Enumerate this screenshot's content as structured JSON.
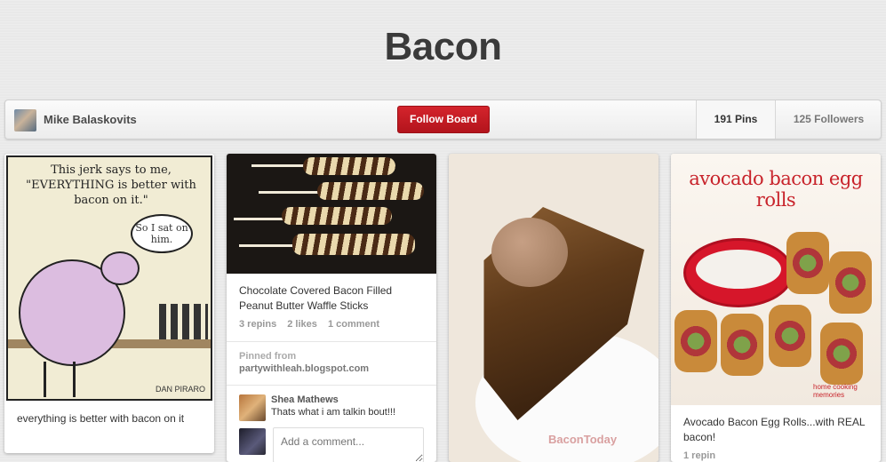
{
  "board": {
    "title": "Bacon"
  },
  "owner": {
    "name": "Mike Balaskovits"
  },
  "actions": {
    "follow_label": "Follow Board"
  },
  "stats": {
    "pins": "191 Pins",
    "followers": "125 Followers"
  },
  "pins": [
    {
      "image_text": "This jerk says to me, \"EVERYTHING is better with bacon on it.\"",
      "bubble_text": "So I sat on him.",
      "signature": "DAN PIRARO",
      "description": "everything is better with bacon on it"
    },
    {
      "description": "Chocolate Covered Bacon Filled Peanut Butter Waffle Sticks",
      "repins": "3 repins",
      "likes": "2 likes",
      "comments": "1 comment",
      "pinned_from_label": "Pinned from",
      "source": "partywithleah.blogspot.com",
      "comment": {
        "user": "Shea Mathews",
        "text": "Thats what i am talkin bout!!!"
      },
      "comment_placeholder": "Add a comment..."
    },
    {
      "watermark": "BaconToday"
    },
    {
      "image_title": "avocado bacon egg rolls",
      "brand": "home cooking memories",
      "description": "Avocado Bacon Egg Rolls...with REAL bacon!",
      "repins": "1 repin"
    }
  ]
}
